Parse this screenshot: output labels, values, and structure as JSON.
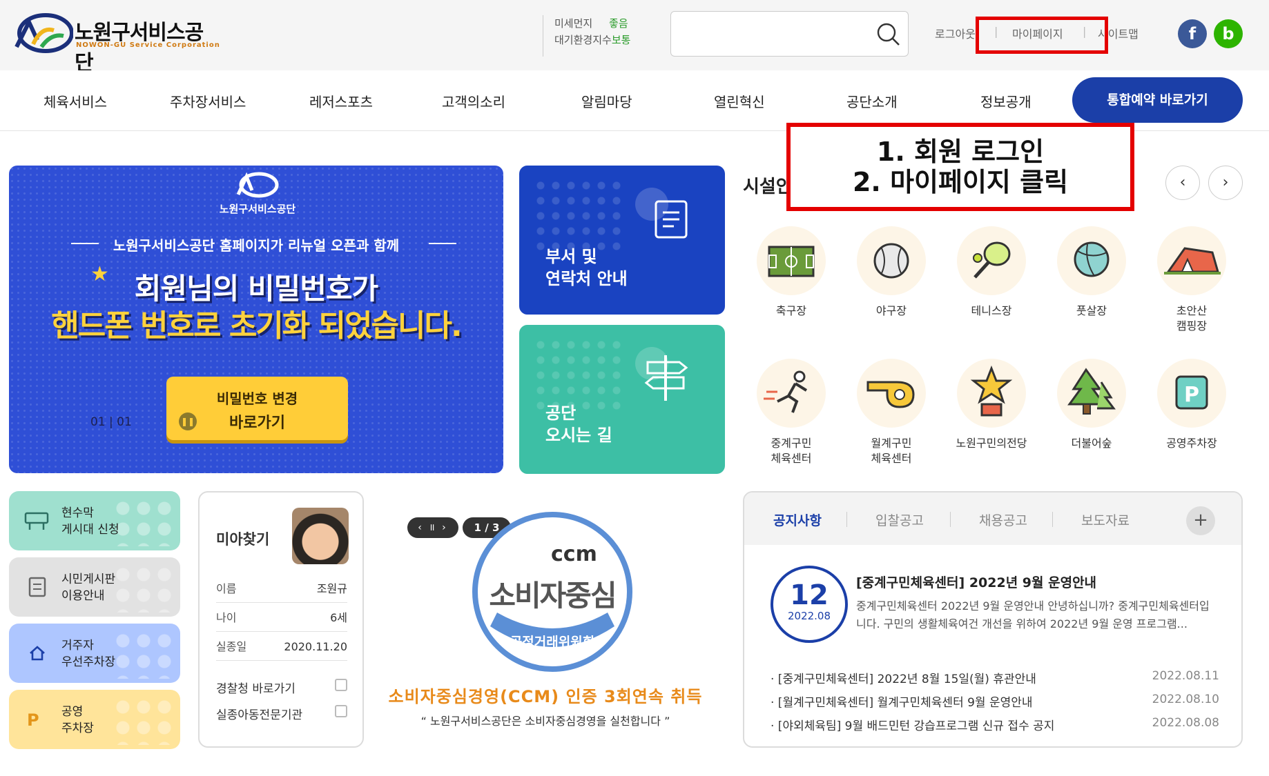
{
  "header": {
    "logo_ko": "노원구서비스공단",
    "logo_en": "NOWON-GU Service Corporation",
    "air": {
      "dust_label": "미세먼지",
      "dust_value": "좋음",
      "index_label": "대기환경지수",
      "index_value": "보통"
    },
    "search_placeholder": "",
    "util": {
      "login": "로그아웃",
      "mypage": "마이페이지",
      "sitemap": "사이트맵"
    },
    "sns": {
      "facebook": "f",
      "blog": "b"
    }
  },
  "gnb": {
    "items": [
      "체육서비스",
      "주차장서비스",
      "레저스포츠",
      "고객의소리",
      "알림마당",
      "열린혁신",
      "공단소개",
      "정보공개"
    ],
    "reserve": "통합예약 바로가기"
  },
  "annotation": {
    "line1": "1. 회원 로그인",
    "line2": "2. 마이페이지 클릭"
  },
  "banner": {
    "logo_text": "노원구서비스공단",
    "sub": "노원구서비스공단 홈페이지가 리뉴얼 오픈과 함께",
    "title1": "회원님의 비밀번호가",
    "title2": "핸드폰 번호로 초기화 되었습니다.",
    "btn_line1": "비밀번호 변경",
    "btn_line2": "바로가기",
    "pager": "01 | 01"
  },
  "tiles": {
    "dept": {
      "line1": "부서 및",
      "line2": "연락처 안내"
    },
    "way": {
      "line1": "공단",
      "line2": "오시는 길"
    }
  },
  "facilities": {
    "title": "시설안내",
    "items": [
      {
        "name1": "축구장",
        "name2": ""
      },
      {
        "name1": "야구장",
        "name2": ""
      },
      {
        "name1": "테니스장",
        "name2": ""
      },
      {
        "name1": "풋살장",
        "name2": ""
      },
      {
        "name1": "초안산",
        "name2": "캠핑장"
      },
      {
        "name1": "중계구민",
        "name2": "체육센터"
      },
      {
        "name1": "월계구민",
        "name2": "체육센터"
      },
      {
        "name1": "노원구민의전당",
        "name2": ""
      },
      {
        "name1": "더불어숲",
        "name2": ""
      },
      {
        "name1": "공영주차장",
        "name2": ""
      }
    ]
  },
  "quick": [
    {
      "line1": "현수막",
      "line2": "게시대 신청",
      "color": "#9fe0cf"
    },
    {
      "line1": "시민게시판",
      "line2": "이용안내",
      "color": "#e2e2e2"
    },
    {
      "line1": "거주자",
      "line2": "우선주차장",
      "color": "#aec6ff"
    },
    {
      "line1": "공영",
      "line2": "주차장",
      "color": "#ffe49a"
    }
  ],
  "missing": {
    "title": "미아찾기",
    "rows": [
      {
        "label": "이름",
        "value": "조원규"
      },
      {
        "label": "나이",
        "value": "6세"
      },
      {
        "label": "실종일",
        "value": "2020.11.20"
      }
    ],
    "links": [
      "경찰청 바로가기",
      "실종아동전문기관"
    ]
  },
  "ccm": {
    "ctrl": "‹ ॥ ›",
    "page": "1 / 3",
    "logo": "ccm",
    "seal_text": "소비자중심",
    "seal_band": "공정거래위원회",
    "caption": "소비자중심경영(CCM) 인증 3회연속 취득",
    "sub": "“ 노원구서비스공단은 소비자중심경영을 실천합니다 ”"
  },
  "board": {
    "tabs": [
      "공지사항",
      "입찰공고",
      "채용공고",
      "보도자료"
    ],
    "more": "+",
    "featured": {
      "day": "12",
      "month": "2022.08",
      "title": "[중계구민체육센터] 2022년 9월 운영안내",
      "summary": "중계구민체육센터 2022년 9월 운영안내 안녕하십니까? 중계구민체육센터입니다. 구민의 생활체육여건 개선을 위하여 2022년 9월 운영 프로그램..."
    },
    "list": [
      {
        "title": "· [중계구민체육센터] 2022년 8월 15일(월) 휴관안내",
        "date": "2022.08.11"
      },
      {
        "title": "· [월계구민체육센터] 월계구민체육센터 9월 운영안내",
        "date": "2022.08.10"
      },
      {
        "title": "· [야외체육팀] 9월 배드민턴 강습프로그램 신규 접수 공지",
        "date": "2022.08.08"
      }
    ]
  },
  "colors": {
    "primary": "#1b3fa8",
    "banner": "#2f4fd6",
    "teal": "#3dbfa5",
    "highlight": "#e40000",
    "accent": "#ffcd38"
  }
}
